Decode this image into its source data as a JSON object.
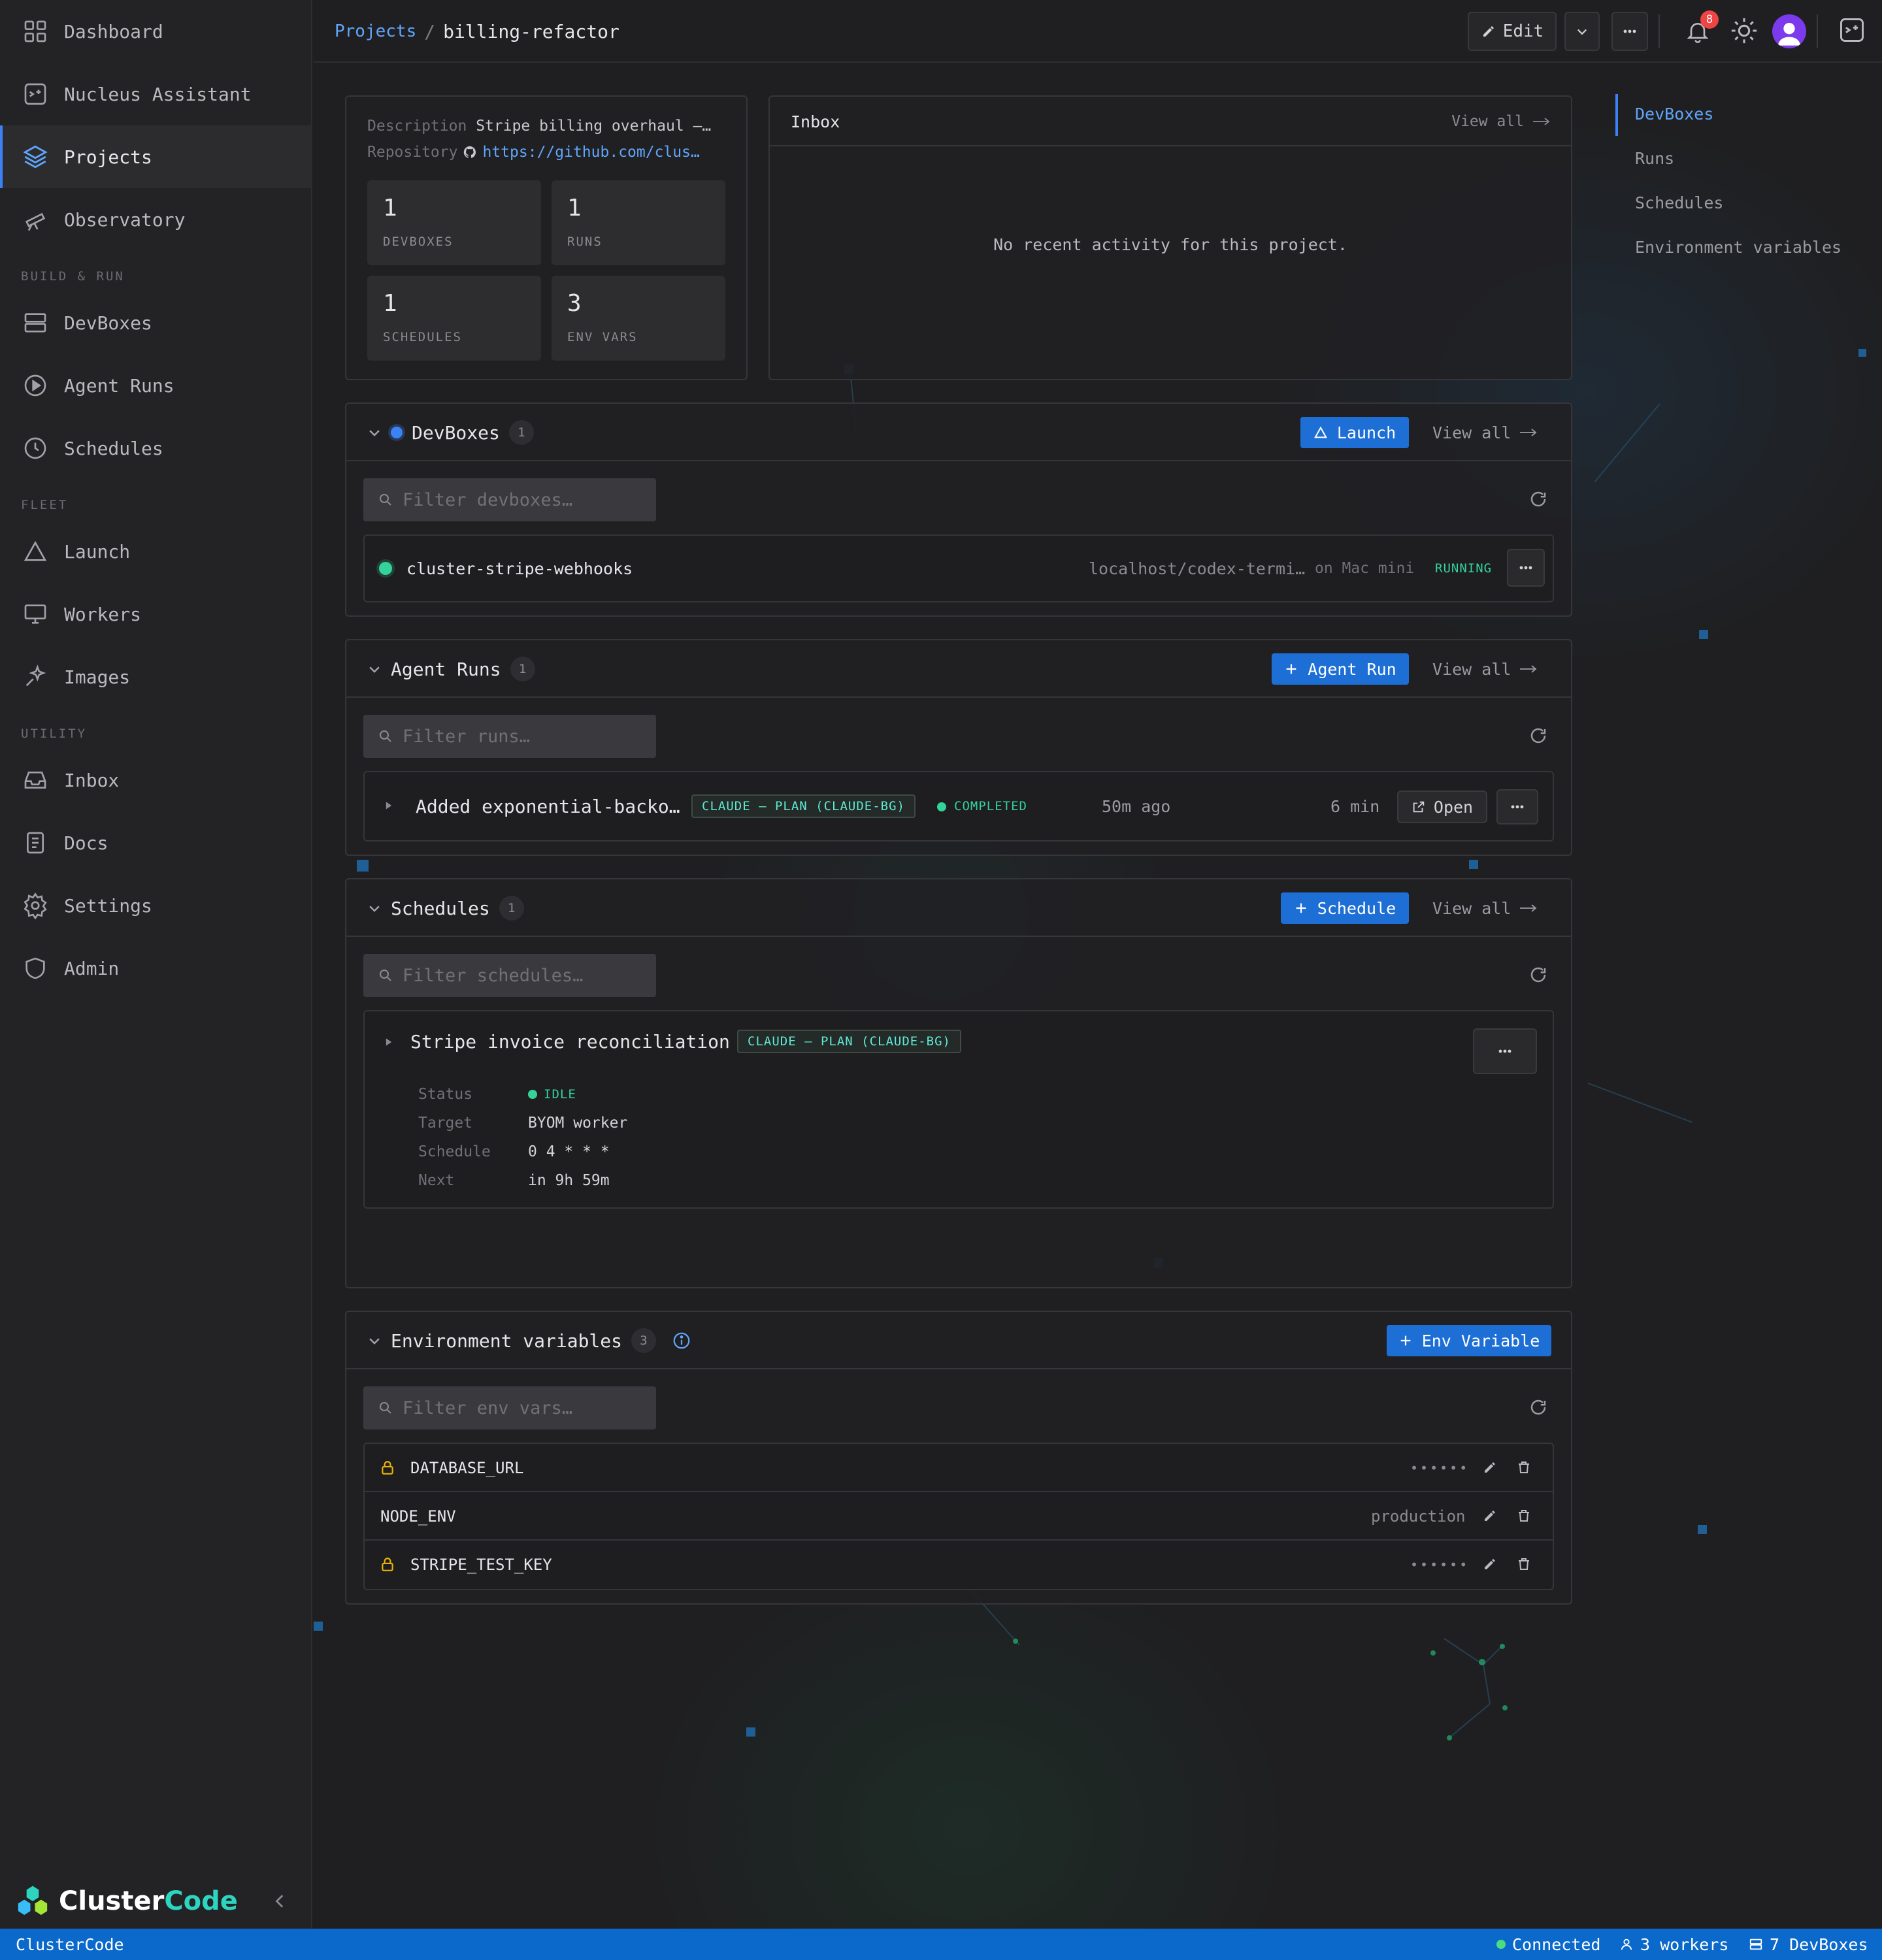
{
  "sidebar": {
    "items": [
      {
        "label": "Dashboard",
        "icon": "dashboard-icon"
      },
      {
        "label": "Nucleus Assistant",
        "icon": "assistant-icon"
      },
      {
        "label": "Projects",
        "icon": "layers-icon",
        "active": true
      },
      {
        "label": "Observatory",
        "icon": "telescope-icon"
      }
    ],
    "sections": [
      {
        "title": "BUILD & RUN",
        "items": [
          {
            "label": "DevBoxes",
            "icon": "server-icon"
          },
          {
            "label": "Agent Runs",
            "icon": "play-circle-icon"
          },
          {
            "label": "Schedules",
            "icon": "clock-icon"
          }
        ]
      },
      {
        "title": "FLEET",
        "items": [
          {
            "label": "Launch",
            "icon": "triangle-icon"
          },
          {
            "label": "Workers",
            "icon": "monitor-icon"
          },
          {
            "label": "Images",
            "icon": "sparkle-icon"
          }
        ]
      },
      {
        "title": "UTILITY",
        "items": [
          {
            "label": "Inbox",
            "icon": "inbox-icon"
          },
          {
            "label": "Docs",
            "icon": "document-icon"
          },
          {
            "label": "Settings",
            "icon": "gear-icon"
          },
          {
            "label": "Admin",
            "icon": "shield-icon"
          }
        ]
      }
    ],
    "brand": {
      "part1": "Cluster",
      "part2": "Code"
    }
  },
  "header": {
    "breadcrumb_root": "Projects",
    "breadcrumb_sep": "/",
    "breadcrumb_current": "billing-refactor",
    "edit_label": "Edit",
    "notification_count": "8"
  },
  "project": {
    "description_label": "Description",
    "description_value": "Stripe billing overhaul —…",
    "repository_label": "Repository",
    "repository_value": "https://github.com/clus…",
    "stats": [
      {
        "value": "1",
        "label": "DEVBOXES"
      },
      {
        "value": "1",
        "label": "RUNS"
      },
      {
        "value": "1",
        "label": "SCHEDULES"
      },
      {
        "value": "3",
        "label": "ENV VARS"
      }
    ]
  },
  "inbox": {
    "title": "Inbox",
    "view_all": "View all",
    "empty_text": "No recent activity for this project."
  },
  "devboxes": {
    "title": "DevBoxes",
    "count": "1",
    "launch_label": "Launch",
    "view_all": "View all",
    "filter_placeholder": "Filter devboxes…",
    "items": [
      {
        "name": "cluster-stripe-webhooks",
        "path": "localhost/codex-termi…",
        "host": "on Mac mini",
        "status": "RUNNING"
      }
    ]
  },
  "agent_runs": {
    "title": "Agent Runs",
    "count": "1",
    "add_label": "Agent Run",
    "view_all": "View all",
    "filter_placeholder": "Filter runs…",
    "items": [
      {
        "title": "Added exponential-backo…",
        "tag": "CLAUDE — PLAN (CLAUDE-BG)",
        "status": "COMPLETED",
        "time": "50m ago",
        "duration": "6 min",
        "open_label": "Open"
      }
    ]
  },
  "schedules": {
    "title": "Schedules",
    "count": "1",
    "add_label": "Schedule",
    "view_all": "View all",
    "filter_placeholder": "Filter schedules…",
    "items": [
      {
        "title": "Stripe invoice reconciliation",
        "tag": "CLAUDE — PLAN (CLAUDE-BG)",
        "status_label": "Status",
        "status_value": "IDLE",
        "target_label": "Target",
        "target_value": "BYOM worker",
        "schedule_label": "Schedule",
        "schedule_value": "0 4 * * *",
        "next_label": "Next",
        "next_value": "in 9h 59m"
      }
    ]
  },
  "env_vars": {
    "title": "Environment variables",
    "count": "3",
    "add_label": "Env Variable",
    "filter_placeholder": "Filter env vars…",
    "items": [
      {
        "name": "DATABASE_URL",
        "value": "••••••",
        "secret": true
      },
      {
        "name": "NODE_ENV",
        "value": "production",
        "secret": false
      },
      {
        "name": "STRIPE_TEST_KEY",
        "value": "••••••",
        "secret": true
      }
    ]
  },
  "toc": {
    "items": [
      "DevBoxes",
      "Runs",
      "Schedules",
      "Environment variables"
    ]
  },
  "statusbar": {
    "app_name": "ClusterCode",
    "connection": "Connected",
    "workers": "3 workers",
    "devboxes": "7 DevBoxes"
  },
  "colors": {
    "accent": "#1d6fd6",
    "status_green": "#34d399",
    "tag_teal": "#5eead4",
    "link_blue": "#60a5fa",
    "badge_red": "#ef4444",
    "secret_yellow": "#eab308"
  }
}
